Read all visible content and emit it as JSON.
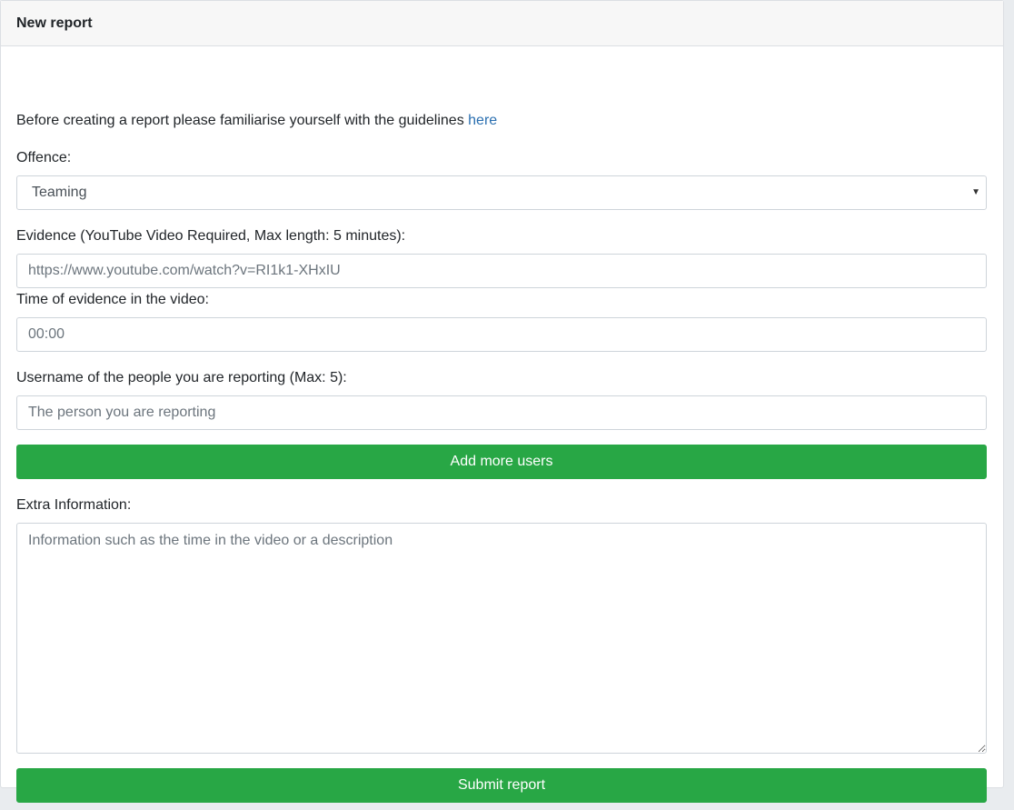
{
  "card": {
    "title": "New report"
  },
  "intro": {
    "text": "Before creating a report please familiarise yourself with the guidelines",
    "link_label": "here"
  },
  "offence": {
    "label": "Offence:",
    "selected": "Teaming"
  },
  "evidence": {
    "label": "Evidence (YouTube Video Required, Max length: 5 minutes):",
    "placeholder": "https://www.youtube.com/watch?v=RI1k1-XHxIU"
  },
  "time": {
    "label": "Time of evidence in the video:",
    "placeholder": "00:00"
  },
  "usernames": {
    "label": "Username of the people you are reporting (Max: 5):",
    "placeholder": "The person you are reporting"
  },
  "add_users_button": "Add more users",
  "extra": {
    "label": "Extra Information:",
    "placeholder": "Information such as the time in the video or a description"
  },
  "submit_button": "Submit report",
  "colors": {
    "success": "#28a745",
    "link": "#2a6fb0"
  }
}
